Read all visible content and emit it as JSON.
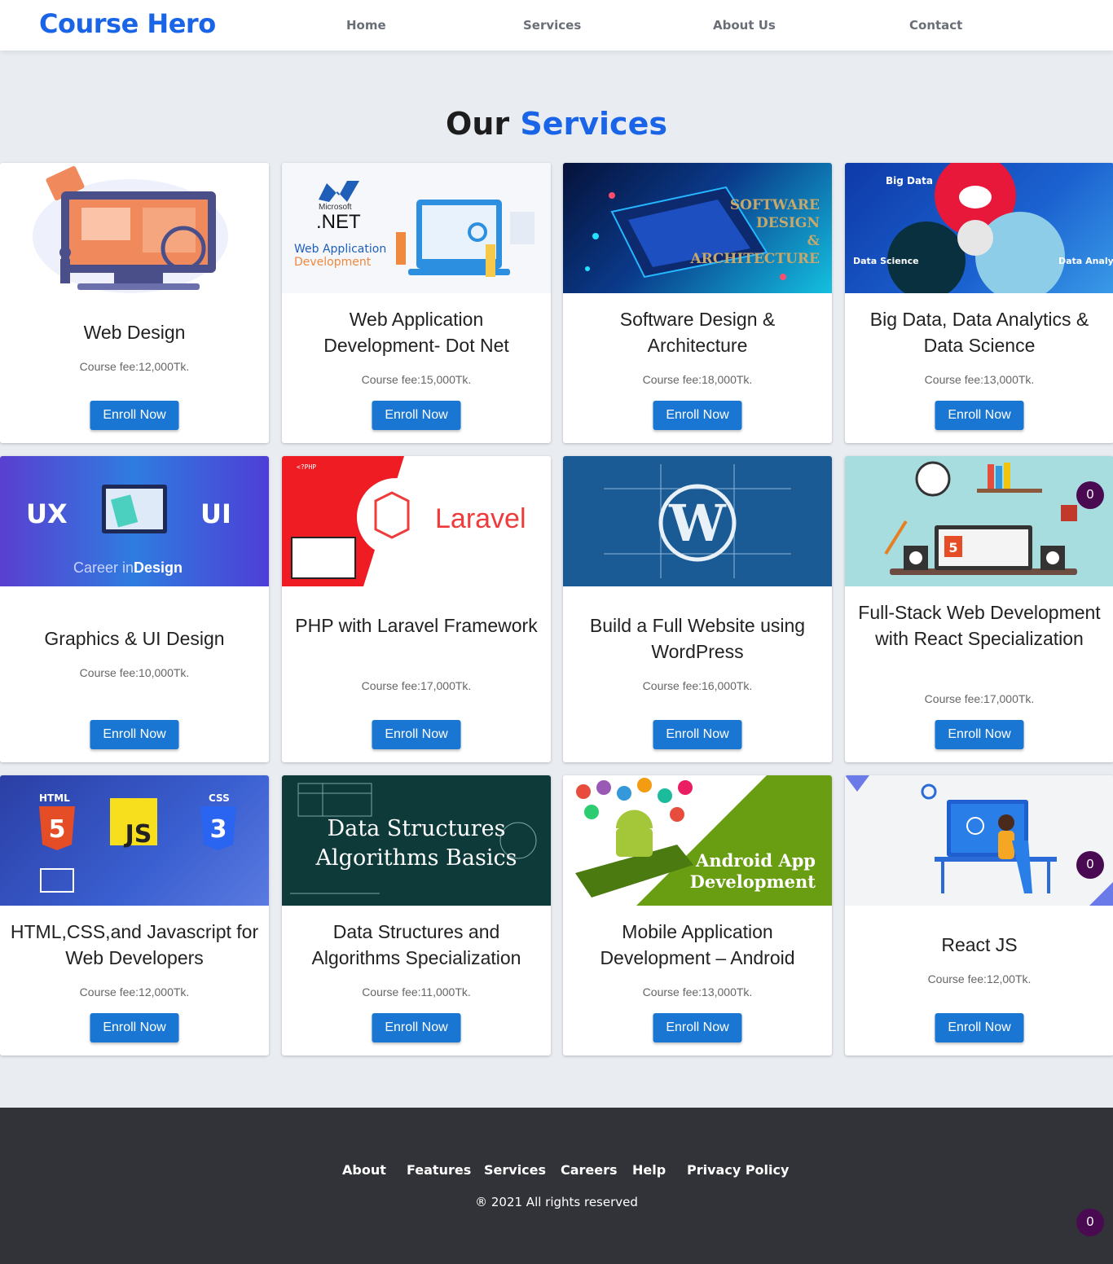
{
  "brand": "Course Hero",
  "nav": [
    "Home",
    "Services",
    "About Us",
    "Contact"
  ],
  "section_title": {
    "prefix": "Our",
    "accent": "Services"
  },
  "cards": [
    {
      "title": "Web Design",
      "fee": "Course fee:12,000Tk.",
      "button": "Enroll Now"
    },
    {
      "title": "Web Application Development- Dot Net",
      "fee": "Course fee:15,000Tk.",
      "button": "Enroll Now",
      "img_text": [
        ".NET",
        "Microsoft",
        "Web Application",
        "Development"
      ]
    },
    {
      "title": "Software Design & Architecture",
      "fee": "Course fee:18,000Tk.",
      "button": "Enroll Now",
      "img_text": [
        "SOFTWARE",
        "DESIGN",
        "&",
        "ARCHITECTURE"
      ]
    },
    {
      "title": "Big Data, Data Analytics & Data Science",
      "fee": "Course fee:13,000Tk.",
      "button": "Enroll Now",
      "img_text": [
        "Big Data",
        "Data Science",
        "Data Analytics"
      ]
    },
    {
      "title": "Graphics & UI Design",
      "fee": "Course fee:10,000Tk.",
      "button": "Enroll Now",
      "img_text": [
        "UX",
        "UI",
        "Career in",
        "Design"
      ]
    },
    {
      "title": "PHP with Laravel Framework",
      "fee": "Course fee:17,000Tk.",
      "button": "Enroll Now",
      "img_text": [
        "Laravel",
        "<?PHP"
      ]
    },
    {
      "title": "Build a Full Website using WordPress",
      "fee": "Course fee:16,000Tk.",
      "button": "Enroll Now",
      "img_text": [
        "W"
      ]
    },
    {
      "title": "Full-Stack Web Development with React Specialization",
      "fee": "Course fee:17,000Tk.",
      "button": "Enroll Now",
      "img_text": [
        "5"
      ]
    },
    {
      "title": "HTML,CSS,and Javascript for Web Developers",
      "fee": "Course fee:12,000Tk.",
      "button": "Enroll Now",
      "img_text": [
        "HTML",
        "5",
        "JS",
        "CSS",
        "3"
      ]
    },
    {
      "title": "Data Structures and Algorithms Specialization",
      "fee": "Course fee:11,000Tk.",
      "button": "Enroll Now",
      "img_text": [
        "Data Structures",
        "Algorithms Basics"
      ]
    },
    {
      "title": "Mobile Application Development – Android",
      "fee": "Course fee:13,000Tk.",
      "button": "Enroll Now",
      "img_text": [
        "Android App",
        "Development"
      ]
    },
    {
      "title": "React JS",
      "fee": "Course fee:12,00Tk.",
      "button": "Enroll Now"
    }
  ],
  "badges": [
    "0",
    "0",
    "0"
  ],
  "footer": {
    "links": [
      "About",
      "Features",
      "Services",
      "Careers",
      "Help",
      "Privacy Policy"
    ],
    "copyright": "® 2021 All rights reserved"
  },
  "colors": {
    "brand": "#1a64e8",
    "button": "#1976d2",
    "footer": "#323338",
    "badge": "#4a0a52"
  }
}
